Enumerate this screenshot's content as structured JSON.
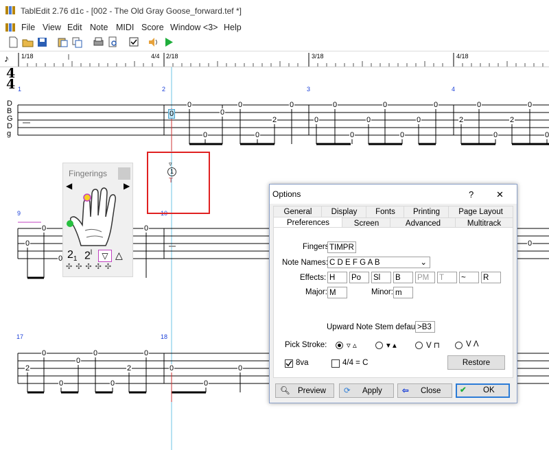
{
  "window": {
    "title": "TablEdit 2.76 d1c  - [002 - The Old Gray Goose_forward.tef *]"
  },
  "menu": [
    "File",
    "View",
    "Edit",
    "Note",
    "MIDI",
    "Score",
    "Window <3>",
    "Help"
  ],
  "ruler": {
    "labels": [
      "1/18",
      "4/4",
      "2/18",
      "3/18",
      "4/18"
    ]
  },
  "score": {
    "time_signature": {
      "top": "4",
      "bottom": "4"
    },
    "string_names": [
      "D",
      "B",
      "G",
      "D",
      "g"
    ],
    "measure_numbers": [
      "1",
      "2",
      "3",
      "4",
      "9",
      "10",
      "17",
      "18"
    ],
    "system1_frets": [
      "0",
      "0",
      "0",
      "0",
      "0",
      "0",
      "2",
      "0",
      "0",
      "0",
      "0",
      "0",
      "0",
      "0",
      "0",
      "0",
      "0",
      "2",
      "2",
      "0",
      "0"
    ],
    "system2_frets": [
      "0",
      "0",
      "0",
      "0",
      "0"
    ],
    "system3_frets": [
      "0",
      "0",
      "0",
      "0",
      "0",
      "2",
      "2",
      "0",
      "0",
      "0",
      "0"
    ],
    "selected_fret": "0",
    "finger_annotation": "1",
    "finger_letter": "T"
  },
  "fingerings": {
    "title": "Fingerings",
    "thumb_marks": [
      "2",
      "2"
    ],
    "thumb_subs": [
      "1",
      "l"
    ]
  },
  "options": {
    "title": "Options",
    "help": "?",
    "close_x": "✕",
    "tabs_row1": [
      "General",
      "Display",
      "Fonts",
      "Printing",
      "Page Layout"
    ],
    "tabs_row2": [
      "Preferences",
      "Screen",
      "Advanced",
      "Multitrack"
    ],
    "active_tab": "Preferences",
    "fingers_label": "Fingers:",
    "fingers_value": "TIMPR",
    "note_names_label": "Note Names:",
    "note_names_value": "C D E F G A B",
    "effects_label": "Effects:",
    "effects": [
      "H",
      "Po",
      "Sl",
      "B",
      "PM",
      "T",
      "~",
      "R"
    ],
    "major_label": "Major:",
    "major_value": "M",
    "minor_label": "Minor:",
    "minor_value": "m",
    "stem_label": "Upward Note Stem default:",
    "stem_value": ">B3",
    "pick_label": "Pick Stroke:",
    "pick_options": [
      "▿ ▵",
      "▾ ▴",
      "V ⊓",
      "V Λ"
    ],
    "pick_selected": 0,
    "check_8va": "8va",
    "check_8va_checked": true,
    "check_44": "4/4 = C",
    "check_44_checked": false,
    "restore": "Restore",
    "preview": "Preview",
    "apply": "Apply",
    "close": "Close",
    "ok": "OK"
  }
}
